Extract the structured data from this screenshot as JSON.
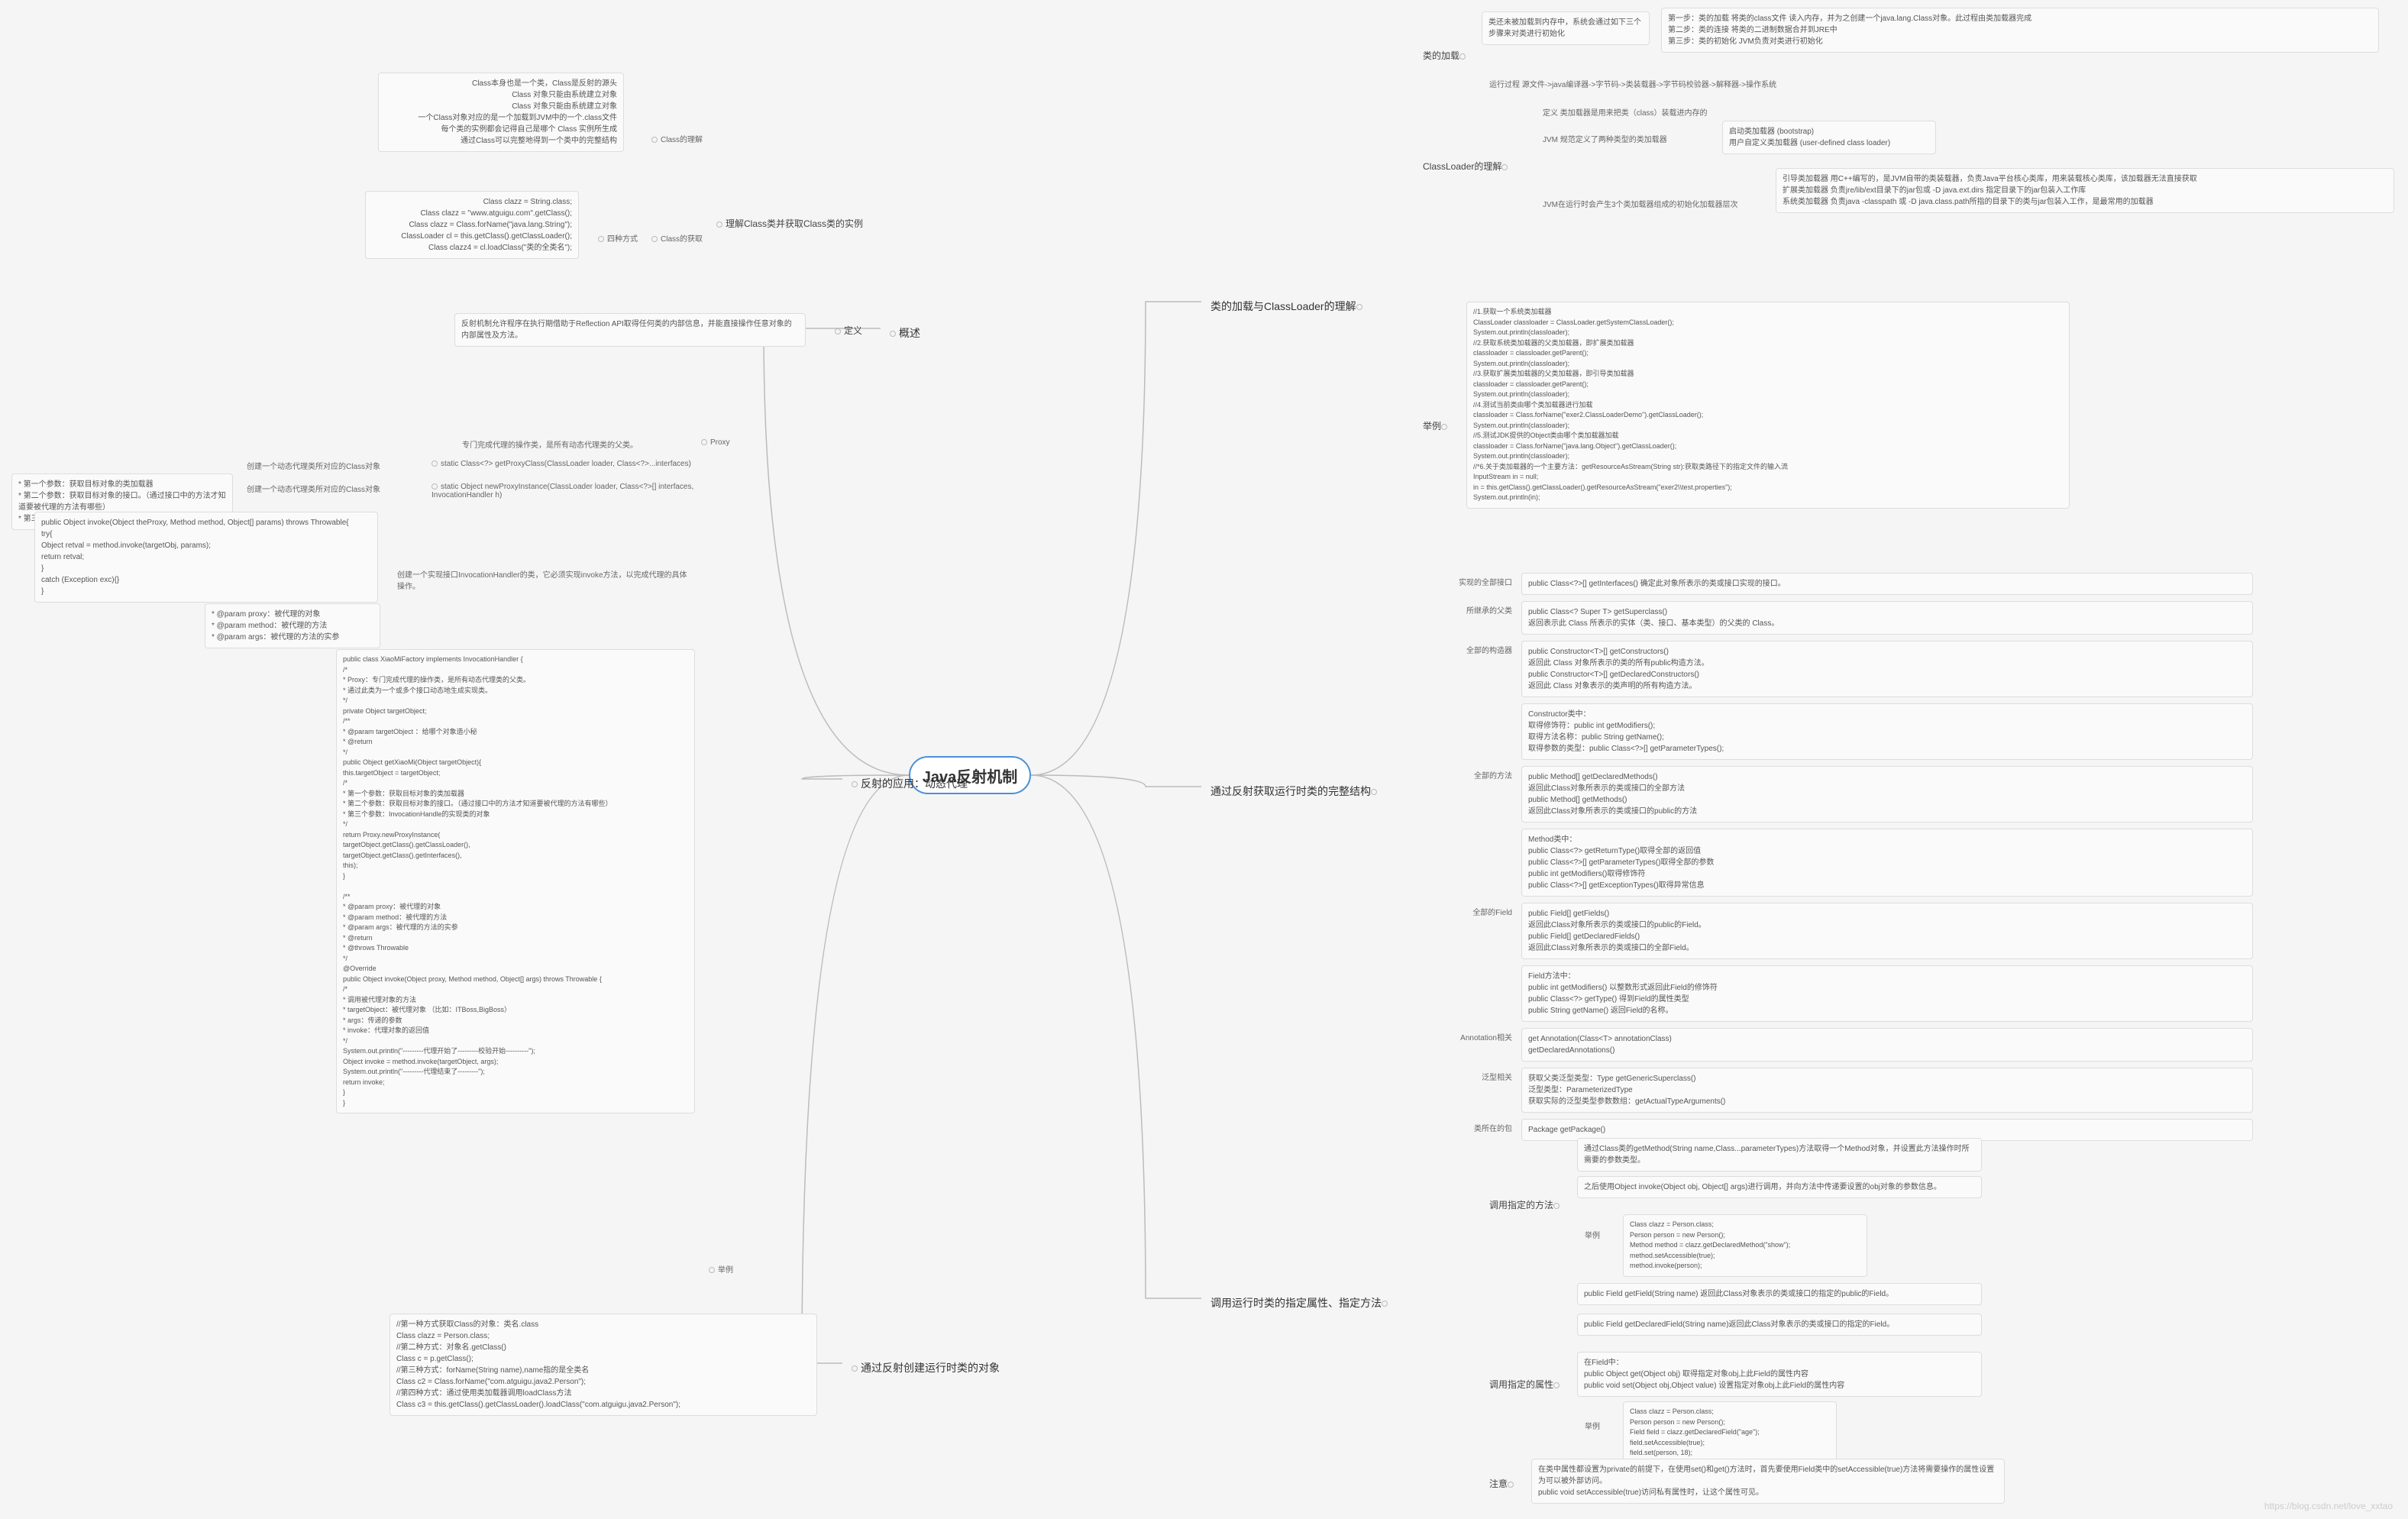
{
  "center": "Java反射机制",
  "b1": {
    "title": "概述",
    "def_label": "定义",
    "def_text": "反射机制允许程序在执行期借助于Reflection API取得任何类的内部信息，并能直接操作任意对象的内部属性及方法。",
    "c1": "理解Class类并获取Class类的实例",
    "c1a": "Class的理解",
    "c1a_items": [
      "Class本身也是一个类，Class是反射的源头",
      "Class 对象只能由系统建立对象",
      "Class 对象只能由系统建立对象",
      "一个Class对象对应的是一个加载到JVM中的一个.class文件",
      "每个类的实例都会记得自己是哪个 Class 实例所生成",
      "通过Class可以完整地得到一个类中的完整结构"
    ],
    "c1b": "Class的获取",
    "c1b_label": "四种方式",
    "c1b_items": [
      "Class clazz = String.class;",
      "Class clazz = \"www.atguigu.com\".getClass();",
      "Class clazz = Class.forName(\"java.lang.String\");",
      "ClassLoader cl = this.getClass().getClassLoader();\nClass clazz4 = cl.loadClass(\"类的全类名\");"
    ]
  },
  "b2": {
    "title": "反射的应用：动态代理",
    "proxy": "Proxy",
    "proxy_desc": "专门完成代理的操作类，是所有动态代理类的父类。",
    "m1": "static Class<?>  getProxyClass(ClassLoader loader, Class<?>...interfaces)",
    "m1_desc": "创建一个动态代理类所对应的Class对象",
    "m2": "static Object  newProxyInstance(ClassLoader loader, Class<?>[] interfaces, InvocationHandler h)",
    "m2_desc": "创建一个动态代理类所对应的Class对象",
    "m2_params": "* 第一个参数：获取目标对象的类加载器\n* 第二个参数：获取目标对象的接口。（通过接口中的方法才知道要被代理的方法有哪些）\n* 第三个参数：InvocationHandle的实现类的对象",
    "invoke_sig": "public Object invoke(Object theProxy, Method method, Object[] params) throws Throwable{\n  try{\n     Object retval = method.invoke(targetObj, params);\n     return retval;\n  }\n  catch (Exception exc){}\n}",
    "invoke_desc": "创建一个实现接口InvocationHandler的类，它必须实现invoke方法，以完成代理的具体操作。",
    "invoke_params": "* @param proxy：被代理的对象\n* @param method：被代理的方法\n* @param args：被代理的方法的实参",
    "example_label": "举例",
    "example_code": "public class XiaoMiFactory implements InvocationHandler {\n /*\n * Proxy：专门完成代理的操作类，是所有动态代理类的父类。\n * 通过此类为一个或多个接口动态地生成实现类。\n */\n private Object targetObject;\n /**\n  * @param targetObject ：给哪个对象造小秘\n  * @return\n  */\n public Object getXiaoMi(Object targetObject){\n    this.targetObject = targetObject;\n    /*\n     * 第一个参数：获取目标对象的类加载器\n     * 第二个参数：获取目标对象的接口。（通过接口中的方法才知道要被代理的方法有哪些）\n     * 第三个参数：InvocationHandle的实现类的对象\n     */\n    return Proxy.newProxyInstance(\n                 targetObject.getClass().getClassLoader(),\n                 targetObject.getClass().getInterfaces(),\n                 this);\n }\n\n /**\n  * @param proxy：被代理的对象\n  * @param method：被代理的方法\n  * @param args：被代理的方法的实参\n  * @return\n  * @throws Throwable\n  */\n @Override\n public Object invoke(Object proxy, Method method, Object[] args) throws Throwable {\n    /*\n     * 调用被代理对象的方法\n     * targetObject：被代理对象 （比如：ITBoss,BigBoss）\n     * args：传递的参数\n     * invoke：代理对象的返回值\n     */\n    System.out.println(\"---------代理开始了---------校验开始----------\");\n       Object invoke = method.invoke(targetObject, args);\n    System.out.println(\"---------代理结束了---------\");\n       return invoke;\n }\n}"
  },
  "b3": {
    "title": "通过反射创建运行时类的对象",
    "code": "//第一种方式获取Class的对象：类名.class\nClass clazz = Person.class;\n//第二种方式：对象名.getClass()\nClass  c = p.getClass();\n//第三种方式：forName(String name),name指的是全类名\nClass c2 = Class.forName(\"com.atguigu.java2.Person\");\n//第四种方式：通过使用类加载器调用loadClass方法\nClass c3 = this.getClass().getClassLoader().loadClass(\"com.atguigu.java2.Person\");"
  },
  "b4": {
    "title": "类的加载与ClassLoader的理解",
    "s1": "类的加载",
    "s1_pre": "类还未被加载到内存中，系统会通过如下三个步骤来对类进行初始化",
    "s1_steps": [
      "第一步：类的加载    将类的class文件 读入内存，并为之创建一个java.lang.Class对象。此过程由类加载器完成",
      "第二步：类的连接    将类的二进制数据合并到JRE中",
      "第三步：类的初始化    JVM负责对类进行初始化"
    ],
    "s1_run": "运行过程    源文件->java编译器->字节码->类装载器->字节码校验器->解释器->操作系统",
    "s2": "ClassLoader的理解",
    "s2_def": "定义    类加载器是用来把类（class）装载进内存的",
    "s2_jvm": "JVM 规范定义了两种类型的类加载器",
    "s2_jvm_items": [
      "启动类加载器 (bootstrap)",
      "用户自定义类加载器 (user-defined class loader)"
    ],
    "s2_3load": "JVM在运行时会产生3个类加载器组成的初始化加载器层次",
    "s2_3load_items": [
      "引导类加载器    用C++编写的，是JVM自带的类装载器，负责Java平台核心类库，用来装载核心类库，该加载器无法直接获取",
      "扩展类加载器    负责jre/lib/ext目录下的jar包或 -D java.ext.dirs 指定目录下的jar包装入工作库",
      "系统类加载器    负责java -classpath 或 -D java.class.path所指的目录下的类与jar包装入工作，是最常用的加载器"
    ],
    "s3": "举例",
    "s3_code": "//1.获取一个系统类加载器\nClassLoader classloader = ClassLoader.getSystemClassLoader();\nSystem.out.println(classloader);\n//2.获取系统类加载器的父类加载器，即扩展类加载器\nclassloader = classloader.getParent();\nSystem.out.println(classloader);\n//3.获取扩展类加载器的父类加载器，即引导类加载器\nclassloader = classloader.getParent();\nSystem.out.println(classloader);\n//4.测试当前类由哪个类加载器进行加载\nclassloader = Class.forName(\"exer2.ClassLoaderDemo\").getClassLoader();\nSystem.out.println(classloader);\n//5.测试JDK提供的Object类由哪个类加载器加载\nclassloader = Class.forName(\"java.lang.Object\").getClassLoader();\nSystem.out.println(classloader);\n//*6.关于类加载器的一个主要方法：getResourceAsStream(String str):获取类路径下的指定文件的输入流\nInputStream in = null;\nin = this.getClass().getClassLoader().getResourceAsStream(\"exer2\\\\test.properties\");\nSystem.out.println(in);"
  },
  "b5": {
    "title": "通过反射获取运行时类的完整结构",
    "rows": [
      {
        "k": "实现的全部接口",
        "v": "public Class<?>[] getInterfaces()  确定此对象所表示的类或接口实现的接口。"
      },
      {
        "k": "所继承的父类",
        "v": "public Class<? Super T> getSuperclass()\n返回表示此 Class 所表示的实体（类、接口、基本类型）的父类的 Class。"
      },
      {
        "k": "全部的构造器",
        "v": "public Constructor<T>[] getConstructors()\n返回此 Class 对象所表示的类的所有public构造方法。\npublic Constructor<T>[] getDeclaredConstructors()\n返回此 Class 对象表示的类声明的所有构造方法。"
      },
      {
        "k": "",
        "v": "Constructor类中：\n取得修饰符：public int getModifiers();\n取得方法名称：public String getName();\n取得参数的类型：public Class<?>[] getParameterTypes();"
      },
      {
        "k": "全部的方法",
        "v": "public Method[] getDeclaredMethods()\n返回此Class对象所表示的类或接口的全部方法\npublic Method[] getMethods()\n返回此Class对象所表示的类或接口的public的方法"
      },
      {
        "k": "",
        "v": "Method类中：\npublic Class<?> getReturnType()取得全部的返回值\npublic Class<?>[] getParameterTypes()取得全部的参数\npublic int getModifiers()取得修饰符\npublic Class<?>[] getExceptionTypes()取得异常信息"
      },
      {
        "k": "全部的Field",
        "v": "public Field[] getFields()\n返回此Class对象所表示的类或接口的public的Field。\npublic Field[] getDeclaredFields()\n返回此Class对象所表示的类或接口的全部Field。"
      },
      {
        "k": "",
        "v": "Field方法中：\npublic int getModifiers() 以整数形式返回此Field的修饰符\npublic Class<?> getType() 得到Field的属性类型\npublic String getName() 返回Field的名称。"
      },
      {
        "k": "Annotation相关",
        "v": "get Annotation(Class<T> annotationClass)\ngetDeclaredAnnotations()"
      },
      {
        "k": "泛型相关",
        "v": "获取父类泛型类型：Type getGenericSuperclass()\n泛型类型：ParameterizedType\n获取实际的泛型类型参数数组：getActualTypeArguments()"
      },
      {
        "k": "类所在的包",
        "v": "Package getPackage()"
      }
    ]
  },
  "b6": {
    "title": "调用运行时类的指定属性、指定方法",
    "s1": "调用指定的方法",
    "s1_a": "通过Class类的getMethod(String name,Class...parameterTypes)方法取得一个Method对象，并设置此方法操作时所需要的参数类型。",
    "s1_b": "之后使用Object invoke(Object obj, Object[] args)进行调用，并向方法中传递要设置的obj对象的参数信息。",
    "s1_ex": "举例",
    "s1_code": "Class clazz = Person.class;\nPerson person = new Person();\nMethod method = clazz.getDeclaredMethod(\"show\");\nmethod.setAccessible(true);\nmethod.invoke(person);",
    "s2": "调用指定的属性",
    "s2_a": "public Field getField(String name) 返回此Class对象表示的类或接口的指定的public的Field。",
    "s2_b": "public Field getDeclaredField(String name)返回此Class对象表示的类或接口的指定的Field。",
    "s2_c": "在Field中：\npublic Object get(Object obj) 取得指定对象obj上此Field的属性内容\npublic void set(Object obj,Object value) 设置指定对象obj上此Field的属性内容",
    "s2_ex": "举例",
    "s2_code": "Class clazz = Person.class;\nPerson person = new Person();\nField field = clazz.getDeclaredField(\"age\");\nfield.setAccessible(true);\nfield.set(person, 18);",
    "s3": "注意",
    "s3_text": "在类中属性都设置为private的前提下，在使用set()和get()方法时，首先要使用Field类中的setAccessible(true)方法将需要操作的属性设置为可以被外部访问。\npublic void setAccessible(true)访问私有属性时，让这个属性可见。"
  },
  "watermark": "https://blog.csdn.net/love_xxtao"
}
